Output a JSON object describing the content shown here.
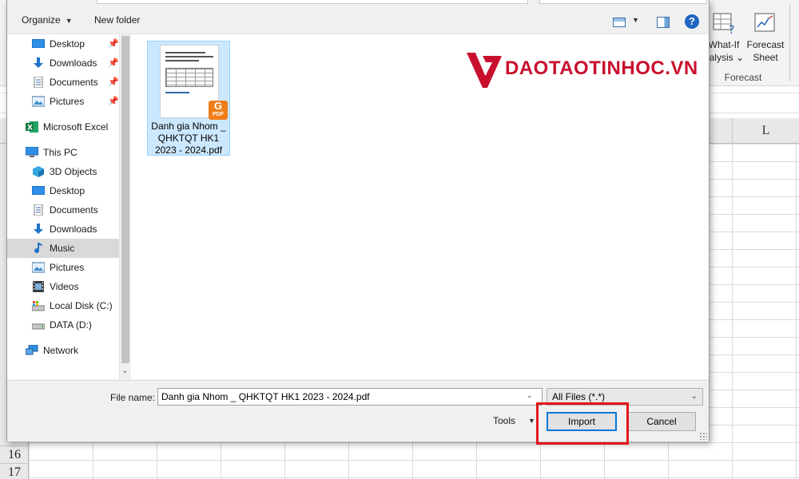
{
  "excel": {
    "ribbon": {
      "whatif_line1": "What-If",
      "whatif_line2": "nalysis",
      "whatif_caret": "⌄",
      "forecast_line1": "Forecast",
      "forecast_line2": "Sheet",
      "group_label": "Forecast"
    },
    "columns": [
      {
        "label": ""
      },
      {
        "label": "L"
      }
    ],
    "rows": [
      "16",
      "17"
    ]
  },
  "dialog": {
    "toolbar": {
      "organize": "Organize",
      "new_folder": "New folder",
      "help": "?"
    },
    "nav": [
      {
        "label": "Desktop",
        "icon": "desktop-icon",
        "pinned": true
      },
      {
        "label": "Downloads",
        "icon": "downloads-icon",
        "pinned": true
      },
      {
        "label": "Documents",
        "icon": "documents-icon",
        "pinned": true
      },
      {
        "label": "Pictures",
        "icon": "pictures-icon",
        "pinned": true
      },
      {
        "label": "Microsoft Excel",
        "icon": "excel-icon",
        "pinned": false
      },
      {
        "label": "This PC",
        "icon": "this-pc-icon",
        "pinned": false
      },
      {
        "label": "3D Objects",
        "icon": "3d-objects-icon",
        "pinned": false
      },
      {
        "label": "Desktop",
        "icon": "desktop-icon",
        "pinned": false
      },
      {
        "label": "Documents",
        "icon": "documents-icon",
        "pinned": false
      },
      {
        "label": "Downloads",
        "icon": "downloads-icon",
        "pinned": false
      },
      {
        "label": "Music",
        "icon": "music-icon",
        "pinned": false,
        "selected": true
      },
      {
        "label": "Pictures",
        "icon": "pictures-icon",
        "pinned": false
      },
      {
        "label": "Videos",
        "icon": "videos-icon",
        "pinned": false
      },
      {
        "label": "Local Disk (C:)",
        "icon": "local-disk-icon",
        "pinned": false
      },
      {
        "label": "DATA (D:)",
        "icon": "drive-icon",
        "pinned": false
      },
      {
        "label": "Network",
        "icon": "network-icon",
        "pinned": false
      }
    ],
    "file": {
      "name_line1": "Danh gia Nhom _",
      "name_line2": "QHKTQT HK1",
      "name_line3": "2023 - 2024.pdf",
      "badge": "PDF"
    },
    "watermark": "DAOTAOTINHOC.VN",
    "bottom": {
      "file_name_label": "File name:",
      "file_name_value": "Danh gia Nhom _ QHKTQT HK1 2023 - 2024.pdf",
      "filter": "All Files (*.*)",
      "tools": "Tools",
      "import": "Import",
      "cancel": "Cancel"
    }
  },
  "colors": {
    "accent": "#0078d7",
    "highlight": "#e3141b",
    "logo": "#c8102e",
    "selection": "#cce8ff"
  }
}
